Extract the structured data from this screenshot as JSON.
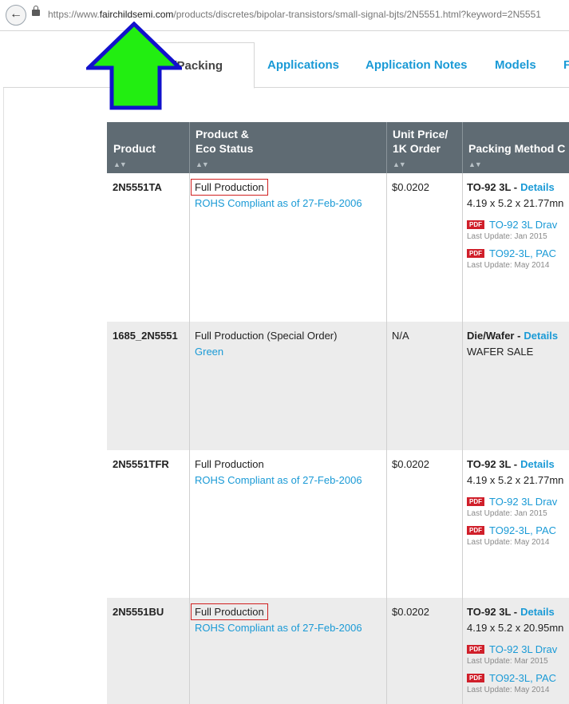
{
  "browser": {
    "url_prefix": "https://www.",
    "url_domain": "fairchildsemi.com",
    "url_rest": "/products/discretes/bipolar-transistors/small-signal-bjts/2N5551.html?keyword=2N5551"
  },
  "tabs": [
    {
      "label": "e/Packing"
    },
    {
      "label": "Applications"
    },
    {
      "label": "Application Notes"
    },
    {
      "label": "Models"
    },
    {
      "label": "F"
    }
  ],
  "table": {
    "headers": [
      {
        "label": "Product"
      },
      {
        "label": "Product &\nEco Status"
      },
      {
        "label": "Unit Price/\n1K Order"
      },
      {
        "label": "Packing Method C"
      }
    ],
    "rows": [
      {
        "product": "2N5551TA",
        "status": "Full Production",
        "eco": "ROHS Compliant as of 27-Feb-2006",
        "price": "$0.0202",
        "package": "TO-92 3L -",
        "details": "Details",
        "dims": "4.19 x 5.2 x 21.77mn",
        "docs": [
          {
            "pdf": "PDF",
            "title": "TO-92 3L  Drav",
            "updated": "Last Update: Jan 2015"
          },
          {
            "pdf": "PDF",
            "title": "TO92-3L, PAC",
            "updated": "Last Update: May 2014"
          }
        ]
      },
      {
        "product": "1685_2N5551",
        "status": "Full Production (Special Order)",
        "eco": "Green",
        "price": "N/A",
        "package": "Die/Wafer -",
        "details": "Details",
        "dims": "WAFER SALE",
        "docs": []
      },
      {
        "product": "2N5551TFR",
        "status": "Full Production",
        "eco": "ROHS Compliant as of 27-Feb-2006",
        "price": "$0.0202",
        "package": "TO-92 3L -",
        "details": "Details",
        "dims": "4.19 x 5.2 x 21.77mn",
        "docs": [
          {
            "pdf": "PDF",
            "title": "TO-92 3L  Drav",
            "updated": "Last Update: Jan 2015"
          },
          {
            "pdf": "PDF",
            "title": "TO92-3L, PAC",
            "updated": "Last Update: May 2014"
          }
        ]
      },
      {
        "product": "2N5551BU",
        "status": "Full Production",
        "eco": "ROHS Compliant as of 27-Feb-2006",
        "price": "$0.0202",
        "package": "TO-92 3L -",
        "details": "Details",
        "dims": "4.19 x 5.2 x 20.95mn",
        "docs": [
          {
            "pdf": "PDF",
            "title": "TO-92 3L  Drav",
            "updated": "Last Update: Mar 2015"
          },
          {
            "pdf": "PDF",
            "title": "TO92-3L, PAC",
            "updated": "Last Update: May 2014"
          }
        ]
      }
    ]
  },
  "colors": {
    "accent": "#1a9ad6",
    "header_bg": "#5f6b73",
    "arrow_fill": "#22ee11",
    "arrow_stroke": "#1111cc",
    "highlight_box": "#d02020"
  },
  "icons": {
    "back": "back-arrow-icon",
    "lock": "lock-icon",
    "sort": "sort-icon",
    "pdf": "pdf-icon",
    "annotation": "up-arrow-annotation"
  }
}
